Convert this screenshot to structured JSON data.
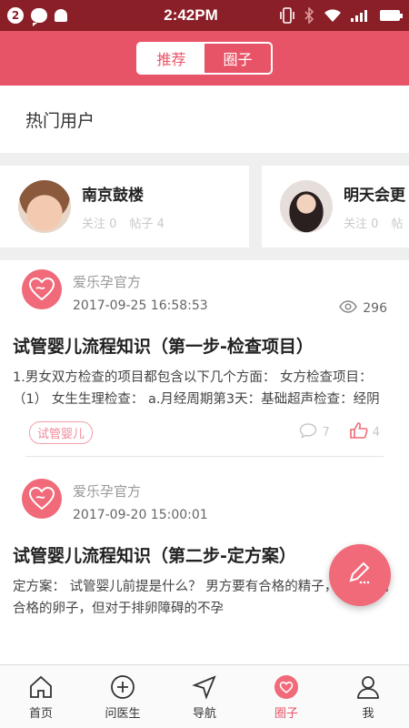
{
  "status_bar": {
    "notification_count": "2",
    "time": "2:42PM"
  },
  "header": {
    "tabs": [
      {
        "label": "推荐",
        "active": true
      },
      {
        "label": "圈子",
        "active": false
      }
    ]
  },
  "hot_users": {
    "title": "热门用户",
    "users": [
      {
        "name": "南京鼓楼",
        "follow": "关注 0",
        "posts": "帖子 4"
      },
      {
        "name": "明天会更",
        "follow": "关注 0",
        "posts": "帖"
      }
    ]
  },
  "feed": {
    "posts": [
      {
        "author": "爱乐孕官方",
        "date": "2017-09-25 16:58:53",
        "views": "296",
        "title": "试管婴儿流程知识（第一步-检查项目）",
        "body": "1.男女双方检查的项目都包含以下几个方面：  女方检查项目：（1） 女生生理检查：  a.月经周期第3天：基础超声检查：经阴",
        "tag": "试管婴儿",
        "comments": "7",
        "likes": "4"
      },
      {
        "author": "爱乐孕官方",
        "date": "2017-09-20 15:00:01",
        "title": "试管婴儿流程知识（第二步-定方案）",
        "body": "定方案：  试管婴儿前提是什么？ 男方要有合格的精子，女方要有合格的卵子，但对于排卵障碍的不孕"
      }
    ]
  },
  "bottom_nav": [
    {
      "label": "首页",
      "icon": "home-icon"
    },
    {
      "label": "问医生",
      "icon": "plus-circle-icon"
    },
    {
      "label": "导航",
      "icon": "navigation-icon"
    },
    {
      "label": "圈子",
      "icon": "heart-circle-icon",
      "active": true
    },
    {
      "label": "我",
      "icon": "user-icon"
    }
  ],
  "colors": {
    "status_bar": "#8a1f28",
    "header": "#e85467",
    "accent": "#f06a7a"
  }
}
